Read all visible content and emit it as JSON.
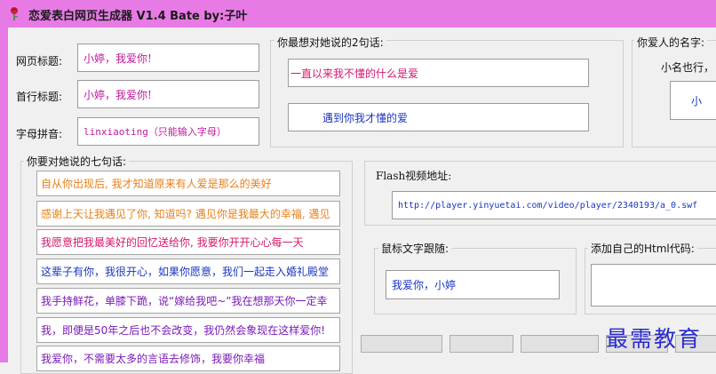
{
  "window": {
    "title": "恋爱表白网页生成器 V1.4 Bate  by:子叶",
    "accent_color": "#e87ae6"
  },
  "fields": {
    "page_title": {
      "label": "网页标题:",
      "value": "小婷，我爱你!"
    },
    "first_line_title": {
      "label": "首行标题:",
      "value": "小婷，我爱你!"
    },
    "pinyin": {
      "label": "字母拼音:",
      "value": "linxiaoting（只能输入字母）"
    }
  },
  "two_sentences": {
    "title": "你最想对她说的2句话:",
    "line1": "一直以来我不懂的什么是爱",
    "line2": "遇到你我才懂的爱"
  },
  "lover_name": {
    "title": "你爱人的名字:",
    "nickname_label": "小名也行，",
    "value": "小"
  },
  "seven_sentences": {
    "title": "你要对她说的七句话:",
    "items": [
      {
        "text": "自从你出现后, 我才知道原来有人爱是那么的美好",
        "color": "#e8801a"
      },
      {
        "text": "感谢上天让我遇见了你, 知道吗? 遇见你是我最大的幸福, 遇见",
        "color": "#e8801a"
      },
      {
        "text": "我愿意把我最美好的回忆送给你, 我要你开开心心每一天",
        "color": "#d6186e"
      },
      {
        "text": "这辈子有你，我很开心，如果你愿意，我们一起走入婚礼殿堂",
        "color": "#1a36c4"
      },
      {
        "text": "我手持鲜花，单膝下跪，说“嫁给我吧~”我在想那天你一定幸",
        "color": "#7a1ab8"
      },
      {
        "text": "我，即便是50年之后也不会改变，我仍然会象现在这样爱你!",
        "color": "#7a1ab8"
      },
      {
        "text": "我爱你，不需要太多的言语去修饰，我要你幸福",
        "color": "#7a1ab8"
      }
    ]
  },
  "flash": {
    "title": "Flash视频地址:",
    "value": "http://player.yinyuetai.com/video/player/2340193/a_0.swf"
  },
  "mouse_text": {
    "title": "鼠标文字跟随:",
    "value": "我爱你，小婷"
  },
  "custom_html": {
    "title": "添加自己的Html代码:",
    "value": ""
  },
  "watermark": "最需教育"
}
